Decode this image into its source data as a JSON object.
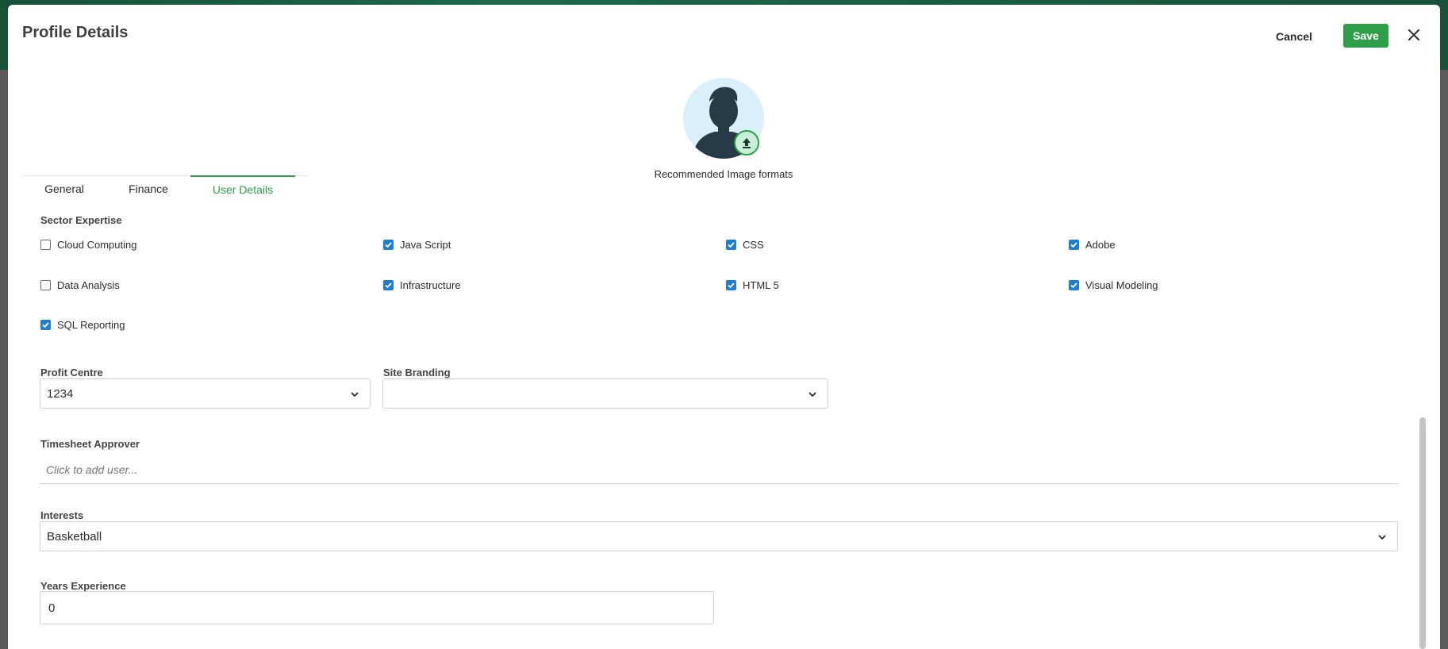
{
  "header": {
    "title": "Profile Details",
    "cancel_label": "Cancel",
    "save_label": "Save",
    "close_icon": "close-icon"
  },
  "avatar": {
    "hint": "Recommended Image formats",
    "upload_icon": "upload-icon"
  },
  "tabs": [
    {
      "label": "General",
      "active": false
    },
    {
      "label": "Finance",
      "active": false
    },
    {
      "label": "User Details",
      "active": true
    }
  ],
  "sector_expertise": {
    "label": "Sector Expertise",
    "options": [
      {
        "label": "Cloud Computing",
        "checked": false
      },
      {
        "label": "Java Script",
        "checked": true
      },
      {
        "label": "CSS",
        "checked": true
      },
      {
        "label": "Adobe",
        "checked": true
      },
      {
        "label": "Data Analysis",
        "checked": false
      },
      {
        "label": "Infrastructure",
        "checked": true
      },
      {
        "label": "HTML 5",
        "checked": true
      },
      {
        "label": "Visual Modeling",
        "checked": true
      },
      {
        "label": "SQL Reporting",
        "checked": true
      }
    ]
  },
  "profit_centre": {
    "label": "Profit Centre",
    "value": "1234"
  },
  "site_branding": {
    "label": "Site Branding",
    "value": ""
  },
  "timesheet_approver": {
    "label": "Timesheet Approver",
    "placeholder": "Click to add user..."
  },
  "interests": {
    "label": "Interests",
    "value": "Basketball"
  },
  "years_experience": {
    "label": "Years Experience",
    "value": "0"
  },
  "colors": {
    "accent": "#2e9e48",
    "checkbox": "#1e7fd2"
  }
}
